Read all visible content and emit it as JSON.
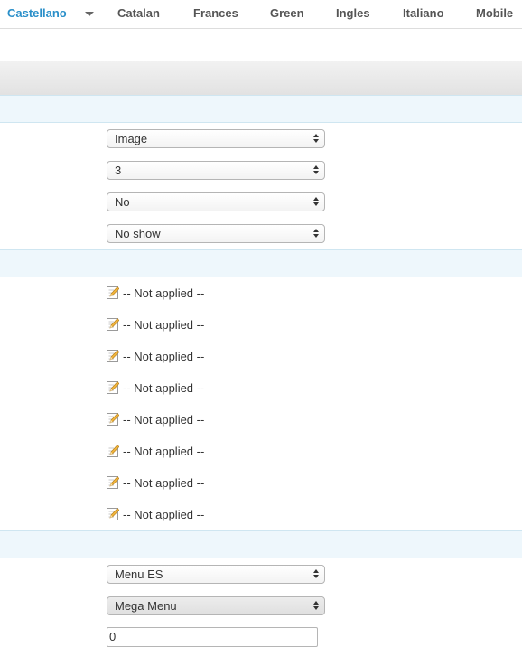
{
  "tabs": {
    "items": [
      {
        "label": "Castellano"
      },
      {
        "label": "Catalan"
      },
      {
        "label": "Frances"
      },
      {
        "label": "Green"
      },
      {
        "label": "Ingles"
      },
      {
        "label": "Italiano"
      },
      {
        "label": "Mobile"
      }
    ],
    "active_color": "#2a8fc9"
  },
  "section1": {
    "selects": [
      {
        "value": "Image"
      },
      {
        "value": "3"
      },
      {
        "value": "No"
      },
      {
        "value": "No show"
      }
    ]
  },
  "section2": {
    "rows": [
      {
        "label": "-- Not applied --"
      },
      {
        "label": "-- Not applied --"
      },
      {
        "label": "-- Not applied --"
      },
      {
        "label": "-- Not applied --"
      },
      {
        "label": "-- Not applied --"
      },
      {
        "label": "-- Not applied --"
      },
      {
        "label": "-- Not applied --"
      },
      {
        "label": "-- Not applied --"
      }
    ],
    "icon": "edit-pencil-icon"
  },
  "section3": {
    "selects": [
      {
        "value": "Menu ES"
      },
      {
        "value": "Mega Menu"
      }
    ],
    "input": {
      "value": "0"
    }
  }
}
